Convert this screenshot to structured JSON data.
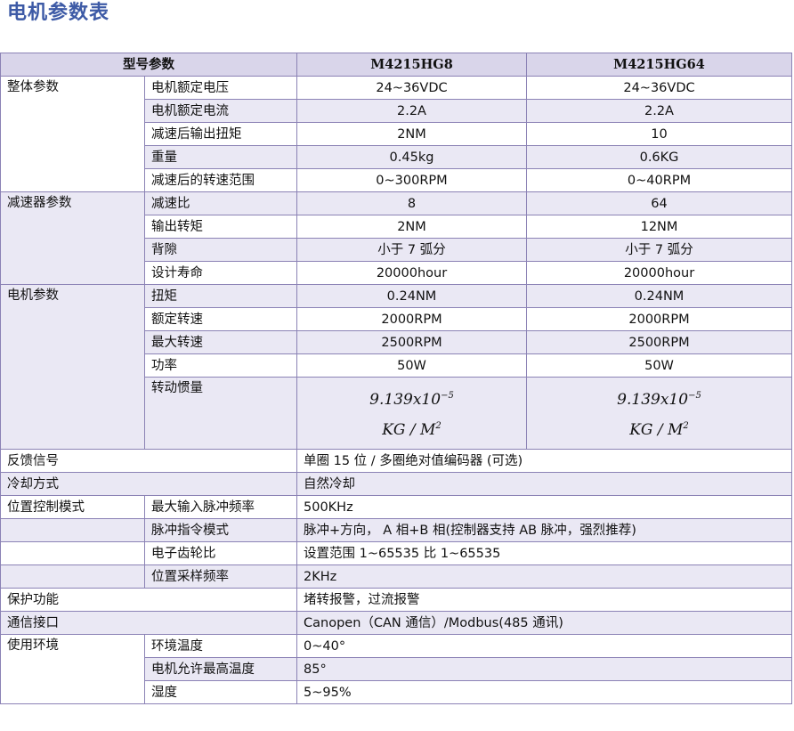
{
  "title": "电机参数表",
  "header": {
    "param": "型号参数",
    "model_a": "M4215HG8",
    "model_b": "M4215HG64"
  },
  "groups": {
    "overall": "整体参数",
    "reducer": "减速器参数",
    "motor": "电机参数",
    "feedback": "反馈信号",
    "cooling": "冷却方式",
    "position_control": "位置控制模式",
    "protection": "保护功能",
    "comm": "通信接口",
    "environment": "使用环境"
  },
  "rows": {
    "rated_voltage": {
      "label": "电机额定电压",
      "a": "24~36VDC",
      "b": "24~36VDC"
    },
    "rated_current": {
      "label": "电机额定电流",
      "a": "2.2A",
      "b": "2.2A"
    },
    "output_torque": {
      "label": "减速后输出扭矩",
      "a": "2NM",
      "b": "10"
    },
    "weight": {
      "label": "重量",
      "a": "0.45kg",
      "b": "0.6KG"
    },
    "speed_range": {
      "label": "减速后的转速范围",
      "a": "0~300RPM",
      "b": "0~40RPM"
    },
    "ratio": {
      "label": "减速比",
      "a": "8",
      "b": "64"
    },
    "out_torque2": {
      "label": "输出转矩",
      "a": "2NM",
      "b": "12NM"
    },
    "backlash": {
      "label": "背隙",
      "a": "小于 7 弧分",
      "b": "小于 7 弧分"
    },
    "life": {
      "label": "设计寿命",
      "a": "20000hour",
      "b": "20000hour"
    },
    "torque": {
      "label": "扭矩",
      "a": "0.24NM",
      "b": "0.24NM"
    },
    "rated_speed": {
      "label": "额定转速",
      "a": "2000RPM",
      "b": "2000RPM"
    },
    "max_speed": {
      "label": "最大转速",
      "a": "2500RPM",
      "b": "2500RPM"
    },
    "power": {
      "label": "功率",
      "a": "50W",
      "b": "50W"
    },
    "inertia": {
      "label": "转动惯量",
      "a_mantissa": "9.139x10",
      "a_exp": "−5",
      "a_unit": "KG / M",
      "a_unit_exp": "2",
      "b_mantissa": "9.139x10",
      "b_exp": "−5",
      "b_unit": "KG / M",
      "b_unit_exp": "2"
    },
    "feedback": "单圈 15 位 / 多圈绝对值编码器 (可选)",
    "cooling": "自然冷却",
    "max_pulse_freq": {
      "label": "最大输入脉冲频率",
      "value": "500KHz"
    },
    "pulse_mode": {
      "label": "脉冲指令模式",
      "value": "脉冲+方向， A 相+B 相(控制器支持 AB 脉冲，强烈推荐)"
    },
    "gear_ratio": {
      "label": "电子齿轮比",
      "value": "设置范围 1~65535 比 1~65535"
    },
    "sample_freq": {
      "label": "位置采样频率",
      "value": "2KHz"
    },
    "protection": "堵转报警，过流报警",
    "comm": "Canopen（CAN 通信）/Modbus(485 通讯)",
    "env_temp": {
      "label": "环境温度",
      "value": "0~40°"
    },
    "motor_max_temp": {
      "label": "电机允许最高温度",
      "value": "85°"
    },
    "humidity": {
      "label": "湿度",
      "value": "5~95%"
    }
  }
}
